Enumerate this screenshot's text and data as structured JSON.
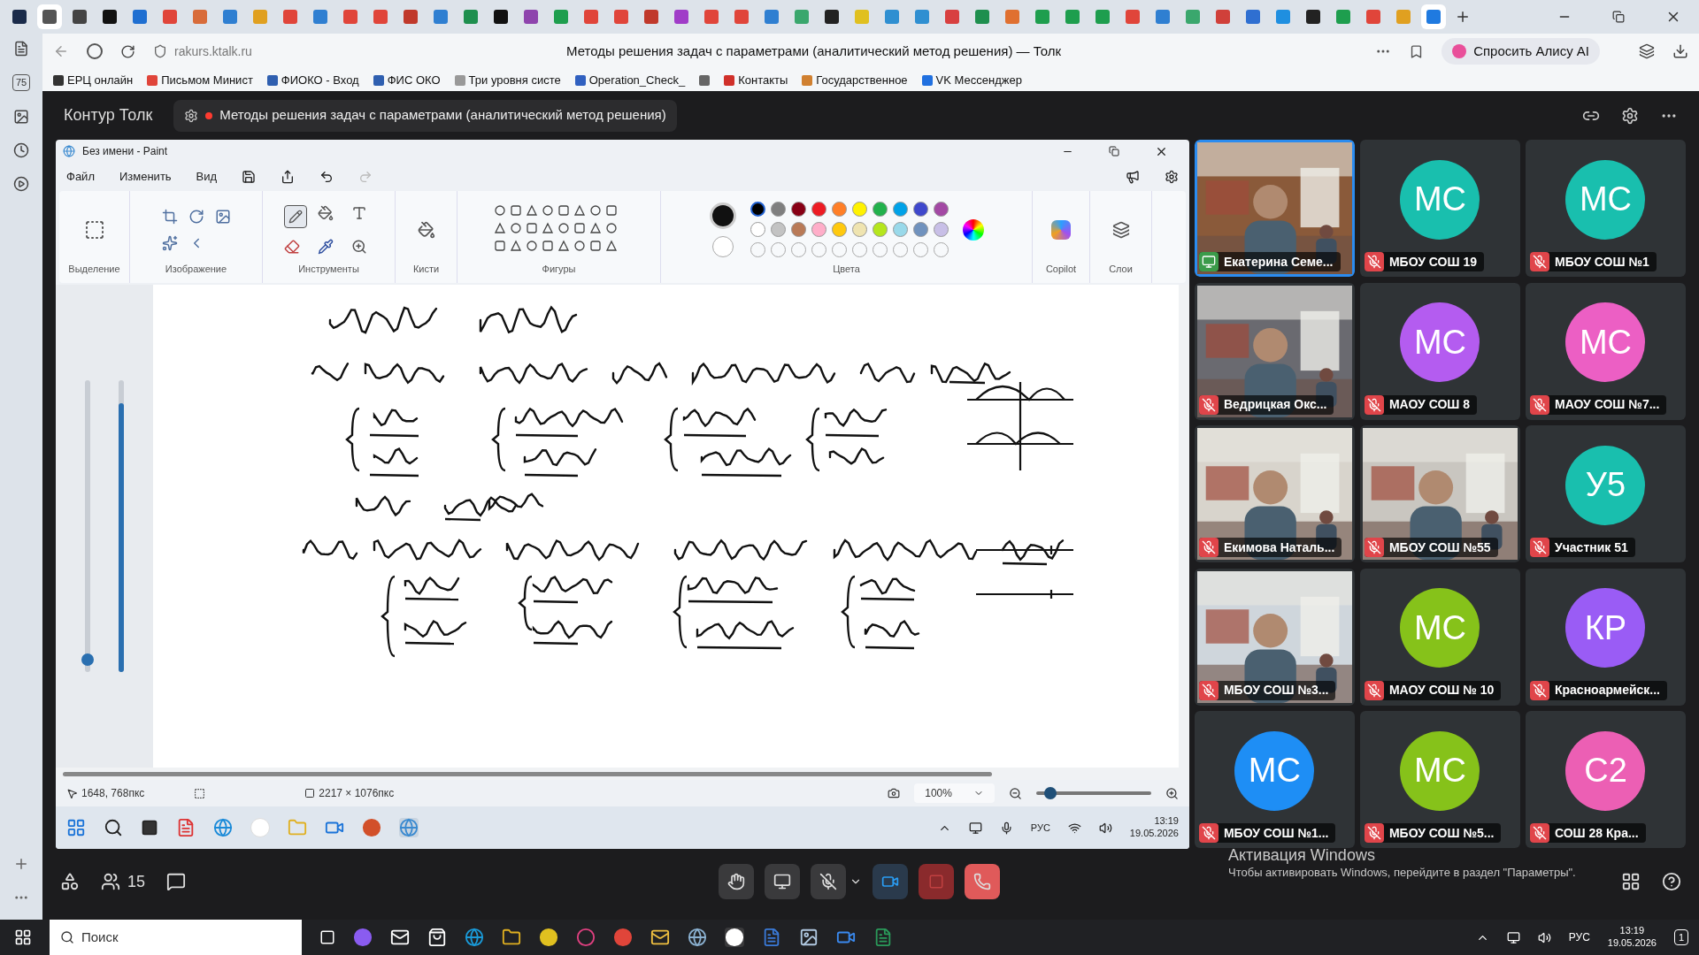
{
  "browser": {
    "tabs": [
      {
        "color": "#1a2b4a",
        "selected": false
      },
      {
        "color": "#555555",
        "selected": true
      },
      {
        "color": "#444444",
        "selected": false
      },
      {
        "color": "#111111",
        "selected": false
      },
      {
        "color": "#1f6fd1",
        "selected": false
      },
      {
        "color": "#e0453a",
        "selected": false
      },
      {
        "color": "#d86c3a",
        "selected": false
      },
      {
        "color": "#2f7fd1",
        "selected": false
      },
      {
        "color": "#e0a020",
        "selected": false
      },
      {
        "color": "#e0453a",
        "selected": false
      },
      {
        "color": "#2f7fd1",
        "selected": false
      },
      {
        "color": "#e0453a",
        "selected": false
      },
      {
        "color": "#e0453a",
        "selected": false
      },
      {
        "color": "#c0392b",
        "selected": false
      },
      {
        "color": "#2f7fd1",
        "selected": false
      },
      {
        "color": "#1e8f4e",
        "selected": false
      },
      {
        "color": "#111111",
        "selected": false
      },
      {
        "color": "#8e44ad",
        "selected": false
      },
      {
        "color": "#1e9e4e",
        "selected": false
      },
      {
        "color": "#e0453a",
        "selected": false
      },
      {
        "color": "#e0453a",
        "selected": false
      },
      {
        "color": "#c0392b",
        "selected": false
      },
      {
        "color": "#a03cc8",
        "selected": false
      },
      {
        "color": "#e0453a",
        "selected": false
      },
      {
        "color": "#e0453a",
        "selected": false
      },
      {
        "color": "#2f7fd1",
        "selected": false
      },
      {
        "color": "#3aa76d",
        "selected": false
      },
      {
        "color": "#222222",
        "selected": false
      },
      {
        "color": "#e0c020",
        "selected": false
      },
      {
        "color": "#2f8fd1",
        "selected": false
      },
      {
        "color": "#2f8fd1",
        "selected": false
      },
      {
        "color": "#d84040",
        "selected": false
      },
      {
        "color": "#1e8f4e",
        "selected": false
      },
      {
        "color": "#e07030",
        "selected": false
      },
      {
        "color": "#1e9e4e",
        "selected": false
      },
      {
        "color": "#1e9e4e",
        "selected": false
      },
      {
        "color": "#1e9e4e",
        "selected": false
      },
      {
        "color": "#e0453a",
        "selected": false
      },
      {
        "color": "#2f7fd1",
        "selected": false
      },
      {
        "color": "#3aa76d",
        "selected": false
      },
      {
        "color": "#d0403a",
        "selected": false
      },
      {
        "color": "#2f6fd1",
        "selected": false
      },
      {
        "color": "#1f8fe0",
        "selected": false
      },
      {
        "color": "#222222",
        "selected": false
      },
      {
        "color": "#1e9e4e",
        "selected": false
      },
      {
        "color": "#e0453a",
        "selected": false
      },
      {
        "color": "#e0a020",
        "selected": false
      },
      {
        "color": "#1f7ae0",
        "selected": true
      }
    ],
    "sidebar_badge": "75",
    "url": "rakurs.ktalk.ru",
    "page_title": "Методы решения задач с параметрами (аналитический метод решения) — Толк",
    "alice_button": "Спросить Алису AI",
    "bookmarks": [
      {
        "label": "ЕРЦ онлайн",
        "color": "#333333"
      },
      {
        "label": "Письмом Минист",
        "color": "#e0453a"
      },
      {
        "label": "ФИОКО - Вход",
        "color": "#2f5fb0"
      },
      {
        "label": "ФИС ОКО",
        "color": "#2f5fb0"
      },
      {
        "label": "Три уровня систе",
        "color": "#999999"
      },
      {
        "label": "Operation_Check_",
        "color": "#3060c0"
      },
      {
        "color": "#666666"
      },
      {
        "label": "Контакты",
        "color": "#d0302a"
      },
      {
        "label": "Государственное",
        "color": "#d08030"
      },
      {
        "label": "VK Мессенджер",
        "color": "#2070e0"
      }
    ]
  },
  "app": {
    "brand": "Контур Толк",
    "meeting_title": "Методы решения задач с параметрами (аналитический метод решения)",
    "recording": true
  },
  "paint": {
    "title": "Без имени - Paint",
    "menu": [
      "Файл",
      "Изменить",
      "Вид"
    ],
    "groups": [
      "Выделение",
      "Изображение",
      "Инструменты",
      "Кисти",
      "Фигуры",
      "Цвета",
      "Copilot",
      "Слои"
    ],
    "palette": [
      {
        "color": "#000000",
        "selected": true
      },
      {
        "color": "#7f7f7f",
        "selected": false
      },
      {
        "color": "#880015",
        "selected": false
      },
      {
        "color": "#ed1c24",
        "selected": false
      },
      {
        "color": "#ff7f27",
        "selected": false
      },
      {
        "color": "#fff200",
        "selected": false
      },
      {
        "color": "#22b14c",
        "selected": false
      },
      {
        "color": "#00a2e8",
        "selected": false
      },
      {
        "color": "#3f48cc",
        "selected": false
      },
      {
        "color": "#a349a4",
        "selected": false
      },
      {
        "color": "#ffffff",
        "selected": false
      },
      {
        "color": "#c3c3c3",
        "selected": false
      },
      {
        "color": "#b97a57",
        "selected": false
      },
      {
        "color": "#ffaec9",
        "selected": false
      },
      {
        "color": "#ffc90e",
        "selected": false
      },
      {
        "color": "#efe4b0",
        "selected": false
      },
      {
        "color": "#b5e61d",
        "selected": false
      },
      {
        "color": "#99d9ea",
        "selected": false
      },
      {
        "color": "#7092be",
        "selected": false
      },
      {
        "color": "#c8bfe7",
        "selected": false
      }
    ],
    "brush_size": {
      "level": 0.02
    },
    "opacity": {
      "level": 0.92
    },
    "cursor_pos": "1648, 768пкс",
    "canvas_size": "2217 × 1076пкс",
    "zoom": "100%",
    "zoom_slider": {
      "level": 0.12
    },
    "tray_lang": "РУС",
    "tray_time": "13:19",
    "tray_date": "19.05.2026"
  },
  "participants": [
    {
      "name": "Екатерина Семе...",
      "kind": "video",
      "sharing_screen": true,
      "muted": false,
      "speaking": true
    },
    {
      "name": "МБОУ СОШ 19",
      "kind": "avatar",
      "initials": "МС",
      "color": "#19bfae",
      "sharing_screen": false,
      "muted": true,
      "speaking": false
    },
    {
      "name": "МБОУ СОШ №1",
      "kind": "avatar",
      "initials": "МС",
      "color": "#19bfae",
      "sharing_screen": false,
      "muted": true,
      "speaking": false
    },
    {
      "name": "Ведрицкая Окс...",
      "kind": "video",
      "sharing_screen": false,
      "muted": true,
      "speaking": false
    },
    {
      "name": "МАОУ СОШ 8",
      "kind": "avatar",
      "initials": "МС",
      "color": "#b45cf0",
      "sharing_screen": false,
      "muted": true,
      "speaking": false
    },
    {
      "name": "МАОУ СОШ №7...",
      "kind": "avatar",
      "initials": "МС",
      "color": "#ec5fc4",
      "sharing_screen": false,
      "muted": true,
      "speaking": false
    },
    {
      "name": "Екимова Наталь...",
      "kind": "video",
      "sharing_screen": false,
      "muted": true,
      "speaking": false
    },
    {
      "name": "МБОУ СОШ №55",
      "kind": "video",
      "sharing_screen": false,
      "muted": true,
      "speaking": false
    },
    {
      "name": "Участник 51",
      "kind": "avatar",
      "initials": "У5",
      "color": "#19bfae",
      "sharing_screen": false,
      "muted": true,
      "speaking": false
    },
    {
      "name": "МБОУ СОШ №3...",
      "kind": "video",
      "sharing_screen": false,
      "muted": true,
      "speaking": false
    },
    {
      "name": "МАОУ СОШ № 10",
      "kind": "avatar",
      "initials": "МС",
      "color": "#86c21a",
      "sharing_screen": false,
      "muted": true,
      "speaking": false
    },
    {
      "name": "Красноармейск...",
      "kind": "avatar",
      "initials": "КР",
      "color": "#9a5cf5",
      "sharing_screen": false,
      "muted": true,
      "speaking": false
    },
    {
      "name": "МБОУ СОШ №1...",
      "kind": "avatar",
      "initials": "МС",
      "color": "#1e8ef5",
      "sharing_screen": false,
      "muted": true,
      "speaking": false
    },
    {
      "name": "МБОУ СОШ №5...",
      "kind": "avatar",
      "initials": "МС",
      "color": "#86c21a",
      "sharing_screen": false,
      "muted": true,
      "speaking": false
    },
    {
      "name": "СОШ 28 Кра...",
      "kind": "avatar",
      "initials": "С2",
      "color": "#ec5fb4",
      "sharing_screen": false,
      "muted": true,
      "speaking": false
    }
  ],
  "activation": {
    "title": "Активация Windows",
    "text": "Чтобы активировать Windows, перейдите в раздел \"Параметры\"."
  },
  "controls": {
    "participants_count": "15"
  },
  "taskbar": {
    "search_placeholder": "Поиск",
    "lang": "РУС",
    "time": "13:19",
    "date": "19.05.2026",
    "notifications": "1"
  }
}
